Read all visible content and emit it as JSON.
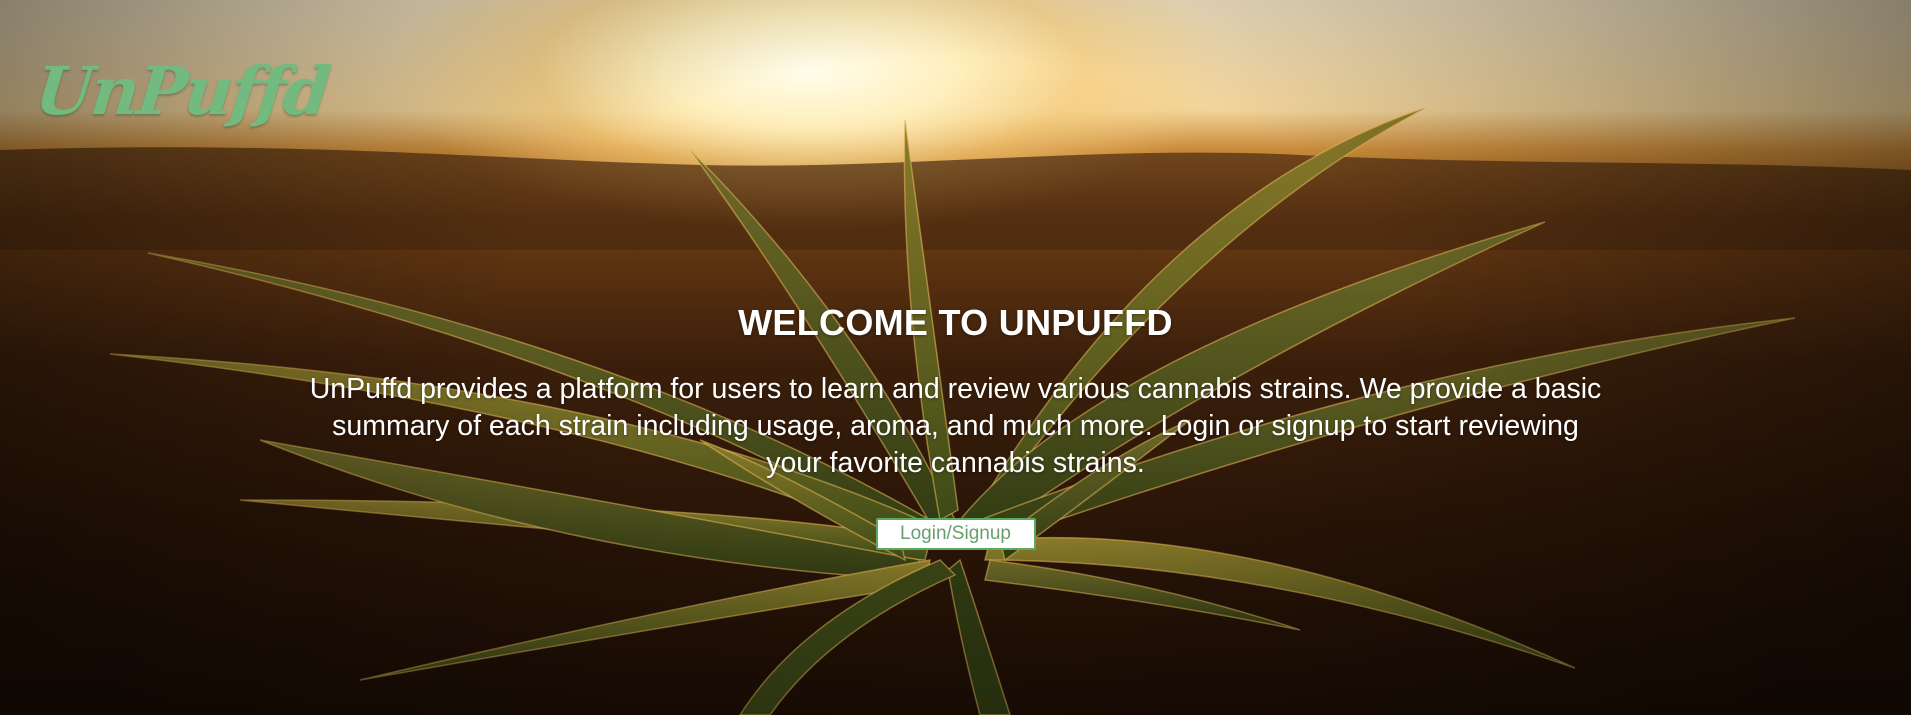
{
  "brand": {
    "logo_text": "UnPuffd",
    "logo_color": "#72ba80"
  },
  "hero": {
    "title": "WELCOME TO UNPUFFD",
    "description": "UnPuffd provides a platform for users to learn and review various cannabis strains. We provide a basic summary of each strain including usage, aroma, and much more. Login or signup to start reviewing your favorite cannabis strains.",
    "cta_label": "Login/Signup",
    "cta_color": "#5aaa62",
    "background_image": "cannabis-plant-sunset"
  }
}
